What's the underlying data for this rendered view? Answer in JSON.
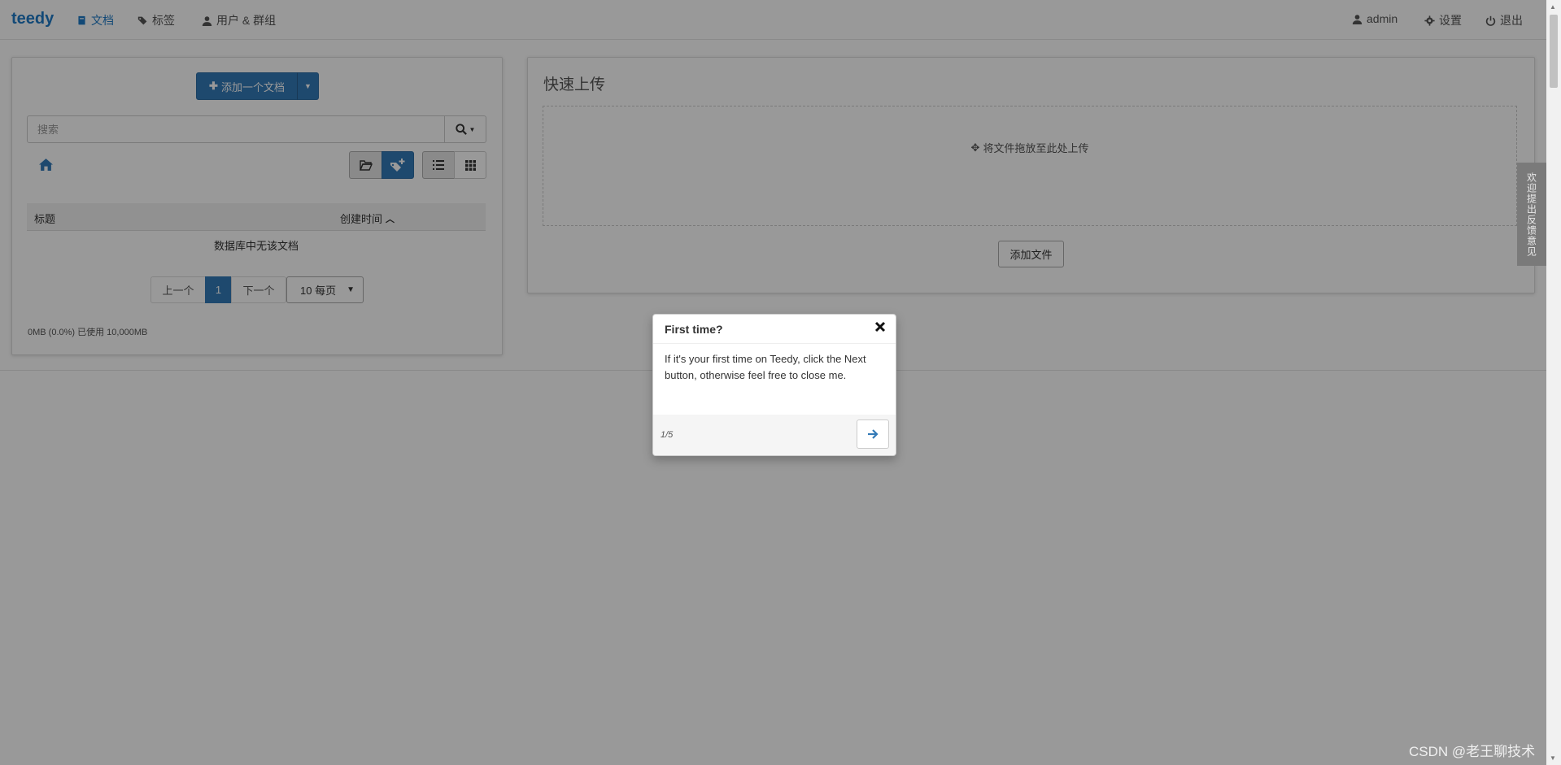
{
  "navbar": {
    "brand": "teedy",
    "documents": "文档",
    "tags": "标签",
    "users_groups": "用户 & 群组",
    "user": "admin",
    "settings": "设置",
    "logout": "退出"
  },
  "left_panel": {
    "add_document_label": "添加一个文档",
    "search_placeholder": "搜索",
    "table": {
      "col_title": "标题",
      "col_created": "创建时间"
    },
    "empty_message": "数据库中无该文档",
    "pagination": {
      "prev": "上一个",
      "current_page": "1",
      "next": "下一个",
      "per_page": "10 每页"
    },
    "quota": "0MB (0.0%) 已使用 10,000MB"
  },
  "quick_upload": {
    "title": "快速上传",
    "drop_hint": "将文件拖放至此处上传",
    "add_file_label": "添加文件"
  },
  "feedback_tab": "欢迎提出反馈意见",
  "tour": {
    "title": "First time?",
    "body": "If it's your first time on Teedy, click the Next button, otherwise feel free to close me.",
    "step": "1/5"
  },
  "watermark": "CSDN @老王聊技术",
  "colors": {
    "brand": "#1f7bc6",
    "primary": "#337ab7"
  }
}
